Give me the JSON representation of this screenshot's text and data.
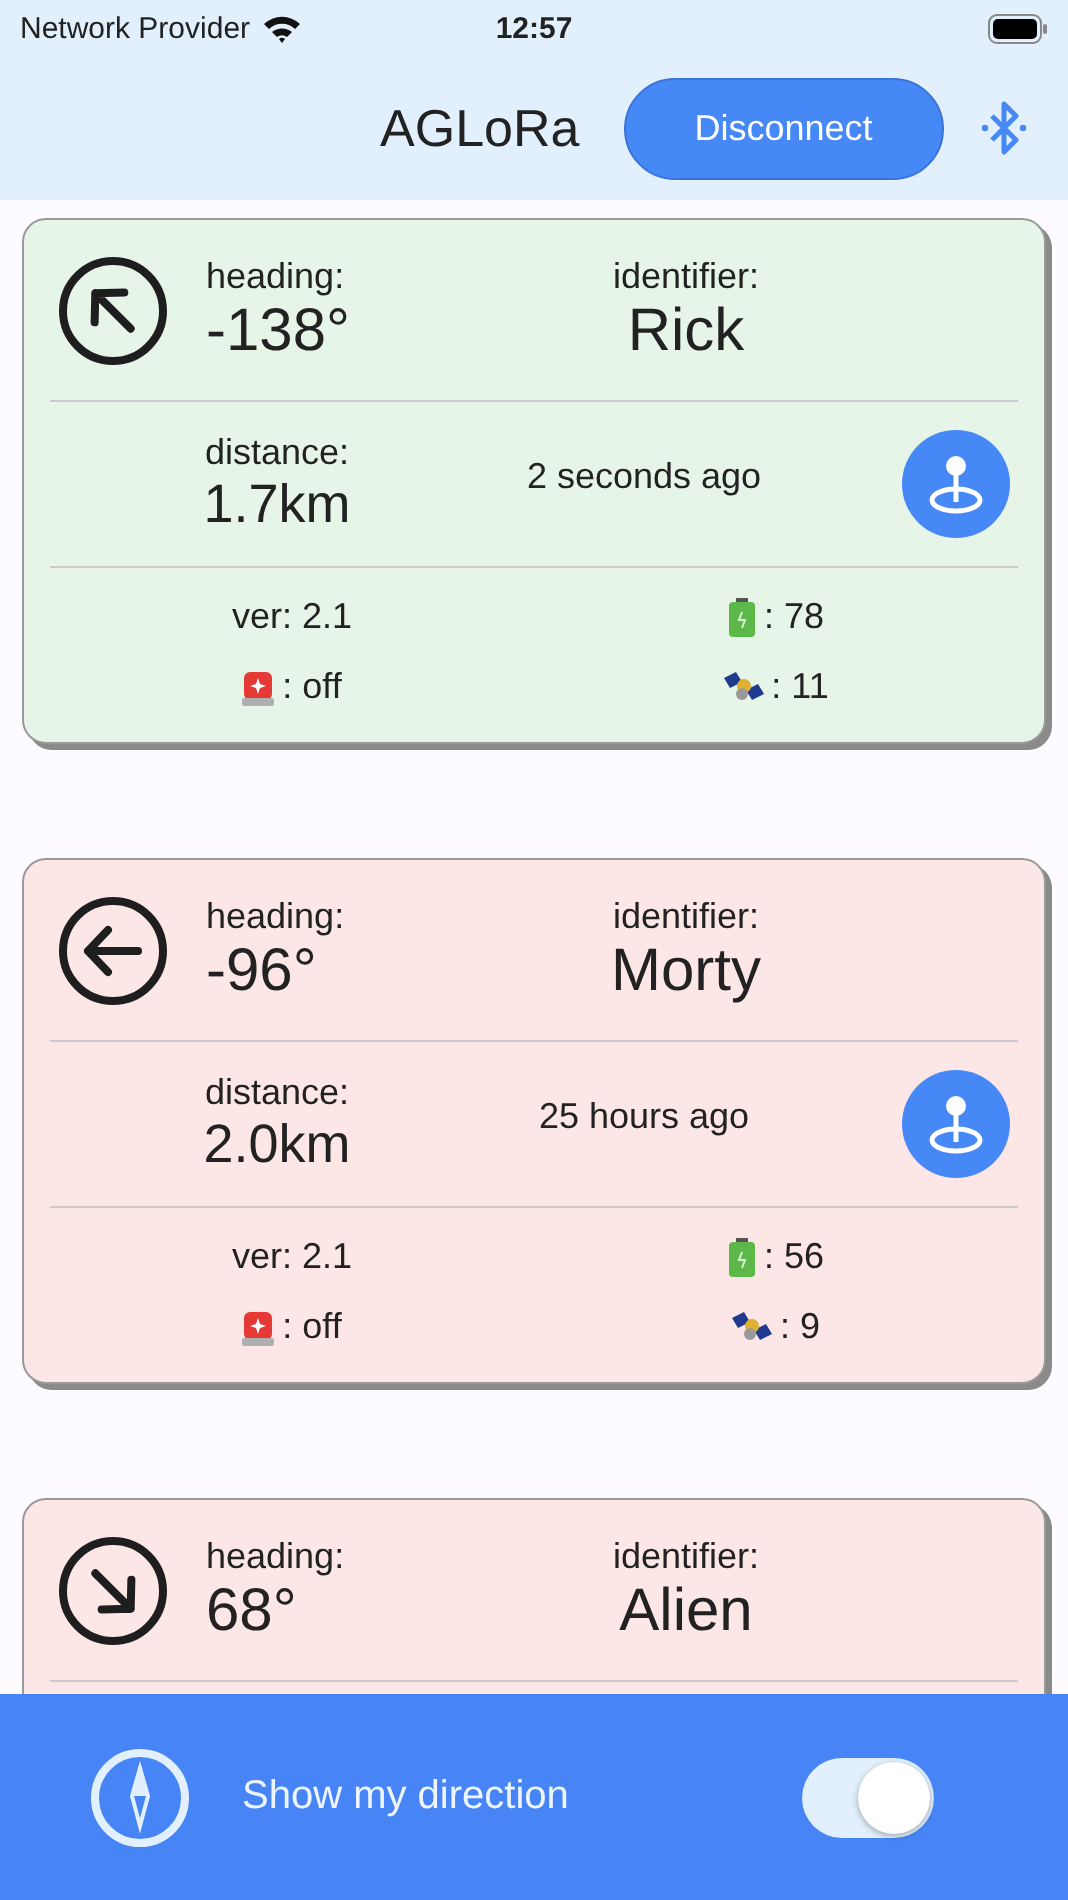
{
  "status_bar": {
    "carrier": "Network Provider",
    "time": "12:57"
  },
  "header": {
    "title": "AGLoRa",
    "button": "Disconnect"
  },
  "cards": [
    {
      "color": "#e6f5e8",
      "kind": "northwest",
      "heading_label": "heading:",
      "heading": "-138°",
      "identifier_label": "identifier:",
      "identifier": "Rick",
      "distance_label": "distance:",
      "distance": "1.7km",
      "updated": "2 seconds ago",
      "version": "ver: 2.1",
      "battery": ": 78",
      "alarm": ": off",
      "satellites": ": 11"
    },
    {
      "color": "#fde6e6",
      "kind": "west",
      "heading_label": "heading:",
      "heading": "-96°",
      "identifier_label": "identifier:",
      "identifier": "Morty",
      "distance_label": "distance:",
      "distance": "2.0km",
      "updated": "25 hours ago",
      "version": "ver: 2.1",
      "battery": ": 56",
      "alarm": ": off",
      "satellites": ": 9"
    },
    {
      "color": "#fde6e6",
      "kind": "southeast",
      "heading_label": "heading:",
      "heading": "68°",
      "identifier_label": "identifier:",
      "identifier": "Alien"
    }
  ],
  "bottom_bar": {
    "label": "Show my direction",
    "toggle": {
      "on": true
    }
  }
}
